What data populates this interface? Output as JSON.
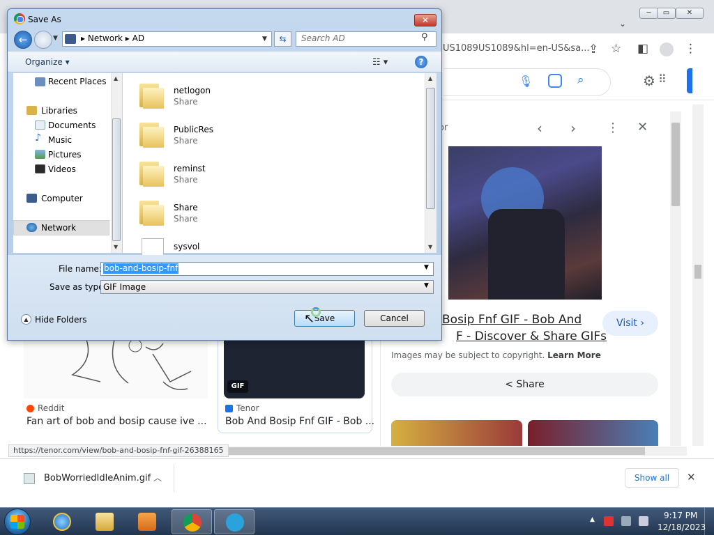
{
  "browser": {
    "url_fragment": "US1089US1089&hl=en-US&sa...",
    "status_url": "https://tenor.com/view/bob-and-bosip-fnf-gif-26388165",
    "results": [
      {
        "source": "Reddit",
        "caption": "Fan art of bob and bosip cause ive ..."
      },
      {
        "source": "Tenor",
        "caption": "Bob And Bosip Fnf GIF - Bob ...",
        "badge": "GIF"
      }
    ],
    "panel": {
      "source": "or",
      "title_line1": "Bosip Fnf GIF - Bob And",
      "title_line2": "F - Discover & Share GIFs",
      "visit_label": "Visit",
      "copyright": "Images may be subject to copyright.",
      "learn_more": "Learn More",
      "share_label": "Share"
    },
    "download": {
      "file_name": "BobWorriedIdleAnim.gif",
      "show_all": "Show all"
    }
  },
  "dialog": {
    "title": "Save As",
    "address": {
      "crumbs": [
        "Network",
        "AD"
      ]
    },
    "search_placeholder": "Search AD",
    "organize_label": "Organize",
    "nav_items": {
      "recent_places": "Recent Places",
      "libraries": "Libraries",
      "documents": "Documents",
      "music": "Music",
      "pictures": "Pictures",
      "videos": "Videos",
      "computer": "Computer",
      "network": "Network"
    },
    "files": [
      {
        "name": "netlogon",
        "type": "Share"
      },
      {
        "name": "PublicRes",
        "type": "Share"
      },
      {
        "name": "reminst",
        "type": "Share"
      },
      {
        "name": "Share",
        "type": "Share"
      },
      {
        "name": "sysvol",
        "type": ""
      }
    ],
    "file_name_label": "File name:",
    "file_name_value": "bob-and-bosip-fnf",
    "save_type_label": "Save as type:",
    "save_type_value": "GIF Image",
    "hide_folders": "Hide Folders",
    "save_button": "Save",
    "cancel_button": "Cancel"
  },
  "taskbar": {
    "time": "9:17 PM",
    "date": "12/18/2023"
  },
  "colors": {
    "accent": "#1a73e8",
    "selection": "#3399ff",
    "taskbar": "#2d4563"
  }
}
